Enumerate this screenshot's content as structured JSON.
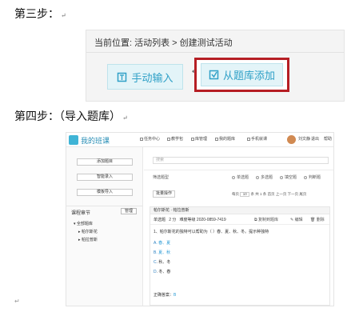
{
  "step3": {
    "title": "第三步：",
    "mark": "↵"
  },
  "shot1": {
    "breadcrumb": "当前位置: 活动列表 > 创建测试活动",
    "manual_label": "手动输入",
    "bank_label": "从题库添加",
    "cursor_mark": "↵"
  },
  "step4": {
    "title": "第四步：（导入题库）",
    "mark": "↵"
  },
  "shot2": {
    "app_name": "我的班课",
    "nav": [
      "任务中心",
      "教学包",
      "库管理",
      "我的题库",
      "手机就课"
    ],
    "user_name": "刘文静",
    "logout": "退出",
    "help": "帮助",
    "side_buttons": [
      "添加题目",
      "智能录入",
      "模板导入"
    ],
    "section_title": "课程章节",
    "manage_label": "管理",
    "tree": [
      "全部题库",
      "帕尔斯花",
      "帕拉普斯"
    ],
    "search_placeholder": "搜索",
    "filter_label": "筛选题型",
    "radios": [
      "单选题",
      "多选题",
      "填空题",
      "判断题"
    ],
    "batch_label": "批量操作",
    "pager": {
      "per_page": "每页",
      "size": "10",
      "unit": "条 共 1 条",
      "first": "首页",
      "prev": "上一页",
      "next": "下一页",
      "last": "尾页"
    },
    "card_head": "帕尔斯花 · 帕拉普斯",
    "q_type": "单选题",
    "q_score": "2 分",
    "q_date": "难度等级  2020-0859-7419",
    "actions": [
      "复制到题库",
      "编辑",
      "删除"
    ],
    "stem": "1、帕尔斯花的独特可以帮助为（ ）春、夏、秋、冬。提示种独特",
    "options": [
      {
        "key": "A",
        "text": "春、夏",
        "correct": true
      },
      {
        "key": "B",
        "text": "夏、秋",
        "correct": true
      },
      {
        "key": "C",
        "text": "秋、冬",
        "correct": false
      },
      {
        "key": "D",
        "text": "冬、春",
        "correct": false
      }
    ],
    "answer_label": "正确答案：",
    "answer_value": "B"
  },
  "footer_mark": "↵"
}
